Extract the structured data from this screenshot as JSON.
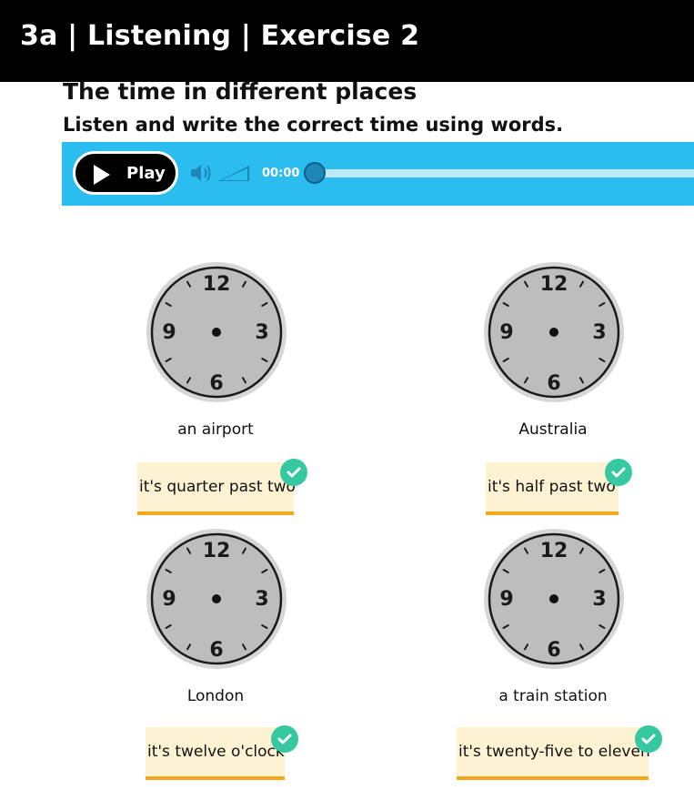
{
  "header": {
    "title": "3a | Listening | Exercise 2"
  },
  "main": {
    "heading": "The time in different places",
    "instruction": "Listen and write the correct time using words."
  },
  "player": {
    "play_label": "Play",
    "time": "00:00",
    "progress": 0,
    "accent": "#2bbcf0"
  },
  "clock_numerals": [
    "12",
    "3",
    "6",
    "9"
  ],
  "items": [
    {
      "place": "an airport",
      "answer": "it's quarter past two",
      "correct": true
    },
    {
      "place": "Australia",
      "answer": "it's half past two",
      "correct": true
    },
    {
      "place": "London",
      "answer": "it's twelve o'clock",
      "correct": true
    },
    {
      "place": "a train station",
      "answer": "it's twenty-five to eleven",
      "correct": true
    }
  ],
  "colors": {
    "check": "#36c8a0",
    "answer_bg": "#fdf3d3",
    "answer_line": "#f2a71f"
  }
}
